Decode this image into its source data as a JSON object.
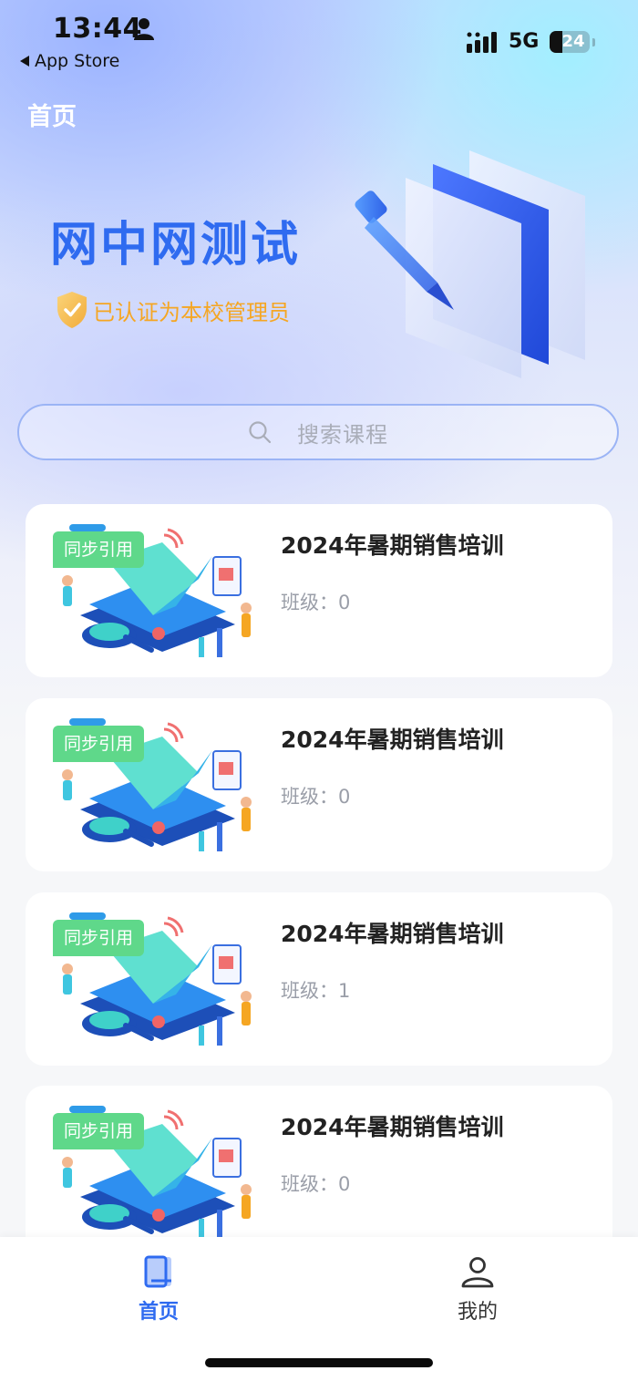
{
  "status_bar": {
    "time": "13:44",
    "back_app": "App Store",
    "network": "5G",
    "battery": "24"
  },
  "header": {
    "title": "首页",
    "school_name": "网中网测试",
    "certification": "已认证为本校管理员"
  },
  "search": {
    "placeholder": "搜索课程"
  },
  "courses": [
    {
      "badge": "同步引用",
      "title": "2024年暑期销售培训",
      "meta": "班级：0"
    },
    {
      "badge": "同步引用",
      "title": "2024年暑期销售培训",
      "meta": "班级：0"
    },
    {
      "badge": "同步引用",
      "title": "2024年暑期销售培训",
      "meta": "班级：1"
    },
    {
      "badge": "同步引用",
      "title": "2024年暑期销售培训",
      "meta": "班级：0"
    }
  ],
  "tabbar": {
    "items": [
      {
        "label": "首页",
        "icon": "book-icon",
        "active": true
      },
      {
        "label": "我的",
        "icon": "user-icon",
        "active": false
      }
    ]
  },
  "colors": {
    "accent": "#2f6bf0",
    "badge": "#5fd88a",
    "certification": "#f5a623",
    "tab_active": "#2f6bf0",
    "tab_inactive": "#333333"
  }
}
